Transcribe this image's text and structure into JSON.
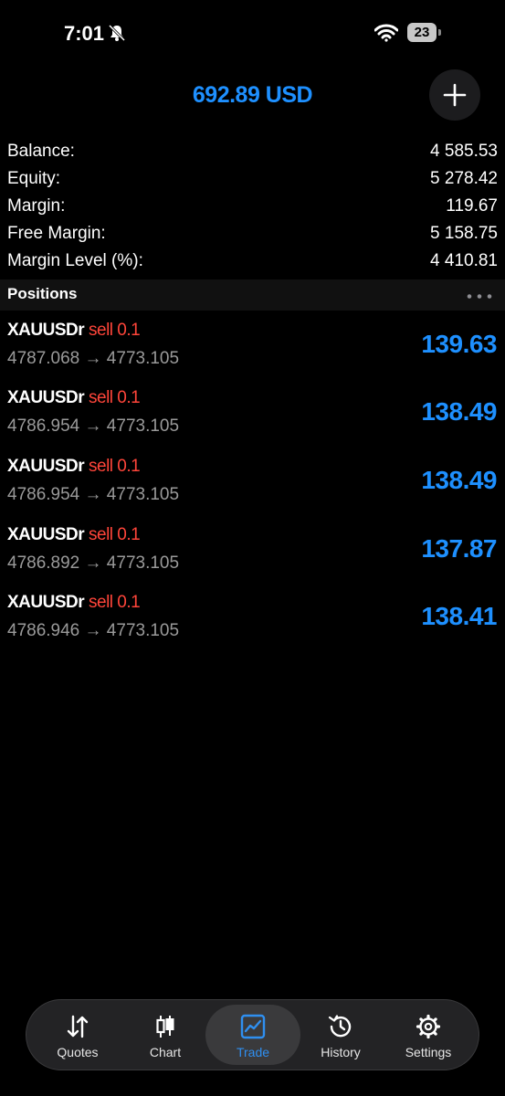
{
  "status_bar": {
    "time": "7:01",
    "battery": "23"
  },
  "header": {
    "title": "692.89 USD"
  },
  "summary": [
    {
      "label": "Balance:",
      "value": "4 585.53"
    },
    {
      "label": "Equity:",
      "value": "5 278.42"
    },
    {
      "label": "Margin:",
      "value": "119.67"
    },
    {
      "label": "Free Margin:",
      "value": "5 158.75"
    },
    {
      "label": "Margin Level (%):",
      "value": "4 410.81"
    }
  ],
  "positions_section": {
    "title": "Positions"
  },
  "positions": [
    {
      "symbol": "XAUUSDr",
      "side": "sell 0.1",
      "prices": "4787.068 → 4773.105",
      "profit": "139.63"
    },
    {
      "symbol": "XAUUSDr",
      "side": "sell 0.1",
      "prices": "4786.954 → 4773.105",
      "profit": "138.49"
    },
    {
      "symbol": "XAUUSDr",
      "side": "sell 0.1",
      "prices": "4786.954 → 4773.105",
      "profit": "138.49"
    },
    {
      "symbol": "XAUUSDr",
      "side": "sell 0.1",
      "prices": "4786.892 → 4773.105",
      "profit": "137.87"
    },
    {
      "symbol": "XAUUSDr",
      "side": "sell 0.1",
      "prices": "4786.946 → 4773.105",
      "profit": "138.41"
    }
  ],
  "tabs": [
    {
      "label": "Quotes",
      "icon": "quotes-icon"
    },
    {
      "label": "Chart",
      "icon": "chart-icon"
    },
    {
      "label": "Trade",
      "icon": "trade-icon",
      "active": true
    },
    {
      "label": "History",
      "icon": "history-icon"
    },
    {
      "label": "Settings",
      "icon": "settings-icon"
    }
  ],
  "colors": {
    "accent": "#1e90ff",
    "sell": "#ff453a",
    "background": "#000000"
  }
}
